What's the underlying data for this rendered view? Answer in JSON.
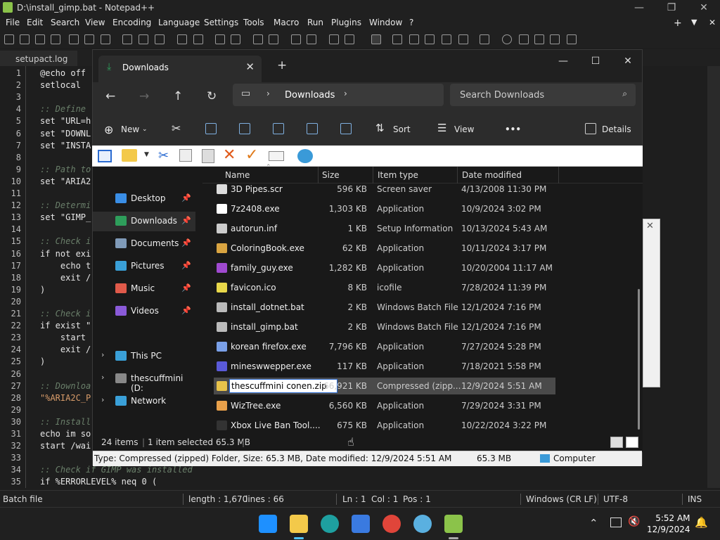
{
  "npp": {
    "title": "D:\\install_gimp.bat - Notepad++",
    "menu": [
      "File",
      "Edit",
      "Search",
      "View",
      "Encoding",
      "Language",
      "Settings",
      "Tools",
      "Macro",
      "Run",
      "Plugins",
      "Window",
      "?"
    ],
    "tab": "setupact.log",
    "line_numbers": [
      "1",
      "2",
      "3",
      "4",
      "5",
      "6",
      "7",
      "8",
      "9",
      "10",
      "11",
      "12",
      "13",
      "14",
      "15",
      "16",
      "17",
      "18",
      "19",
      "20",
      "21",
      "22",
      "23",
      "24",
      "25",
      "26",
      "27",
      "28",
      "29",
      "30",
      "31",
      "32",
      "33",
      "34",
      "35"
    ],
    "code": [
      {
        "text": "@echo off",
        "cls": ""
      },
      {
        "text": "setlocal",
        "cls": ""
      },
      {
        "text": "",
        "cls": ""
      },
      {
        "text": ":: Define",
        "cls": "cmt"
      },
      {
        "text": "set \"URL=h",
        "cls": ""
      },
      {
        "text": "set \"DOWNL",
        "cls": ""
      },
      {
        "text": "set \"INSTA",
        "cls": ""
      },
      {
        "text": "",
        "cls": ""
      },
      {
        "text": ":: Path to",
        "cls": "cmt"
      },
      {
        "text": "set \"ARIA2",
        "cls": ""
      },
      {
        "text": "",
        "cls": ""
      },
      {
        "text": ":: Determi",
        "cls": "cmt"
      },
      {
        "text": "set \"GIMP_",
        "cls": ""
      },
      {
        "text": "",
        "cls": ""
      },
      {
        "text": ":: Check i",
        "cls": "cmt"
      },
      {
        "text": "if not exi",
        "cls": ""
      },
      {
        "text": "    echo t",
        "cls": ""
      },
      {
        "text": "    exit /",
        "cls": ""
      },
      {
        "text": ")",
        "cls": ""
      },
      {
        "text": "",
        "cls": ""
      },
      {
        "text": ":: Check i",
        "cls": "cmt"
      },
      {
        "text": "if exist \"",
        "cls": ""
      },
      {
        "text": "    start",
        "cls": ""
      },
      {
        "text": "    exit /",
        "cls": ""
      },
      {
        "text": ")",
        "cls": ""
      },
      {
        "text": "",
        "cls": ""
      },
      {
        "text": ":: Downloa",
        "cls": "cmt"
      },
      {
        "text": "\"%ARIA2C_P",
        "cls": "str"
      },
      {
        "text": "",
        "cls": ""
      },
      {
        "text": ":: Install",
        "cls": "cmt"
      },
      {
        "text": "echo im so",
        "cls": ""
      },
      {
        "text": "start /wai",
        "cls": ""
      },
      {
        "text": "",
        "cls": ""
      },
      {
        "text": ":: Check if GIMP was installed",
        "cls": "cmt"
      },
      {
        "text": "if %ERRORLEVEL% neq 0 (",
        "cls": ""
      }
    ],
    "status": {
      "lang": "Batch file",
      "length": "length : 1,670",
      "lines": "lines : 66",
      "ln": "Ln : 1",
      "col": "Col : 1",
      "pos": "Pos : 1",
      "eol": "Windows (CR LF)",
      "enc": "UTF-8",
      "mode": "INS"
    }
  },
  "explorer": {
    "tab_title": "Downloads",
    "breadcrumb": "Downloads",
    "search_placeholder": "Search Downloads",
    "cmd": {
      "new": "New",
      "sort": "Sort",
      "view": "View",
      "more": "•••",
      "details": "Details"
    },
    "nav": [
      {
        "label": "Desktop",
        "icon": "desktop-icon",
        "color": "#3a8ee6",
        "pin": true
      },
      {
        "label": "Downloads",
        "icon": "downloads-icon",
        "color": "#2e9e5b",
        "pin": true,
        "sel": true
      },
      {
        "label": "Documents",
        "icon": "documents-icon",
        "color": "#7f9ab8",
        "pin": true
      },
      {
        "label": "Pictures",
        "icon": "pictures-icon",
        "color": "#3aa0d8",
        "pin": true
      },
      {
        "label": "Music",
        "icon": "music-icon",
        "color": "#e05a4a",
        "pin": true
      },
      {
        "label": "Videos",
        "icon": "videos-icon",
        "color": "#8a5ad8",
        "pin": true
      }
    ],
    "nav2": [
      {
        "label": "This PC",
        "icon": "this-pc-icon",
        "color": "#3aa0d8"
      },
      {
        "label": "thescuffmini (D:",
        "icon": "drive-icon",
        "color": "#888"
      },
      {
        "label": "Network",
        "icon": "network-icon",
        "color": "#3aa0d8"
      }
    ],
    "columns": {
      "name": "Name",
      "size": "Size",
      "type": "Item type",
      "date": "Date modified"
    },
    "files": [
      {
        "name": "3D Pipes.scr",
        "size": "596 KB",
        "type": "Screen saver",
        "date": "4/13/2008 11:30 PM",
        "color": "#ddd"
      },
      {
        "name": "7z2408.exe",
        "size": "1,303 KB",
        "type": "Application",
        "date": "10/9/2024 3:02 PM",
        "color": "#fff"
      },
      {
        "name": "autorun.inf",
        "size": "1 KB",
        "type": "Setup Information",
        "date": "10/13/2024 5:43 AM",
        "color": "#ccc"
      },
      {
        "name": "ColoringBook.exe",
        "size": "62 KB",
        "type": "Application",
        "date": "10/11/2024 3:17 PM",
        "color": "#d9a441"
      },
      {
        "name": "family_guy.exe",
        "size": "1,282 KB",
        "type": "Application",
        "date": "10/20/2004 11:17 AM",
        "color": "#a04ad0"
      },
      {
        "name": "favicon.ico",
        "size": "8 KB",
        "type": "icofile",
        "date": "7/28/2024 11:39 PM",
        "color": "#e8d84a"
      },
      {
        "name": "install_dotnet.bat",
        "size": "2 KB",
        "type": "Windows Batch File",
        "date": "12/1/2024 7:16 PM",
        "color": "#bbb"
      },
      {
        "name": "install_gimp.bat",
        "size": "2 KB",
        "type": "Windows Batch File",
        "date": "12/1/2024 7:16 PM",
        "color": "#bbb"
      },
      {
        "name": "korean firefox.exe",
        "size": "7,796 KB",
        "type": "Application",
        "date": "7/27/2024 5:28 PM",
        "color": "#7aa0e8"
      },
      {
        "name": "mineswwepper.exe",
        "size": "117 KB",
        "type": "Application",
        "date": "7/18/2021 5:58 PM",
        "color": "#5a5ad8"
      },
      {
        "name": "thescuffmini conen.zip",
        "size": "66,921 KB",
        "type": "Compressed (zipp...",
        "date": "12/9/2024 5:51 AM",
        "color": "#e8c34a",
        "sel": true
      },
      {
        "name": "WizTree.exe",
        "size": "6,560 KB",
        "type": "Application",
        "date": "7/29/2024 3:31 PM",
        "color": "#e8a04a"
      },
      {
        "name": "Xbox Live Ban Tool....",
        "size": "675 KB",
        "type": "Application",
        "date": "10/22/2024 3:22 PM",
        "color": "#333"
      }
    ],
    "status_items": "24 items",
    "status_sel": "1 item selected  65.3 MB",
    "bottom_info": "Type: Compressed (zipped) Folder, Size: 65.3 MB, Date modified: 12/9/2024 5:51 AM",
    "bottom_size": "65.3 MB",
    "bottom_loc": "Computer"
  },
  "taskbar": {
    "time": "5:52 AM",
    "date": "12/9/2024"
  }
}
